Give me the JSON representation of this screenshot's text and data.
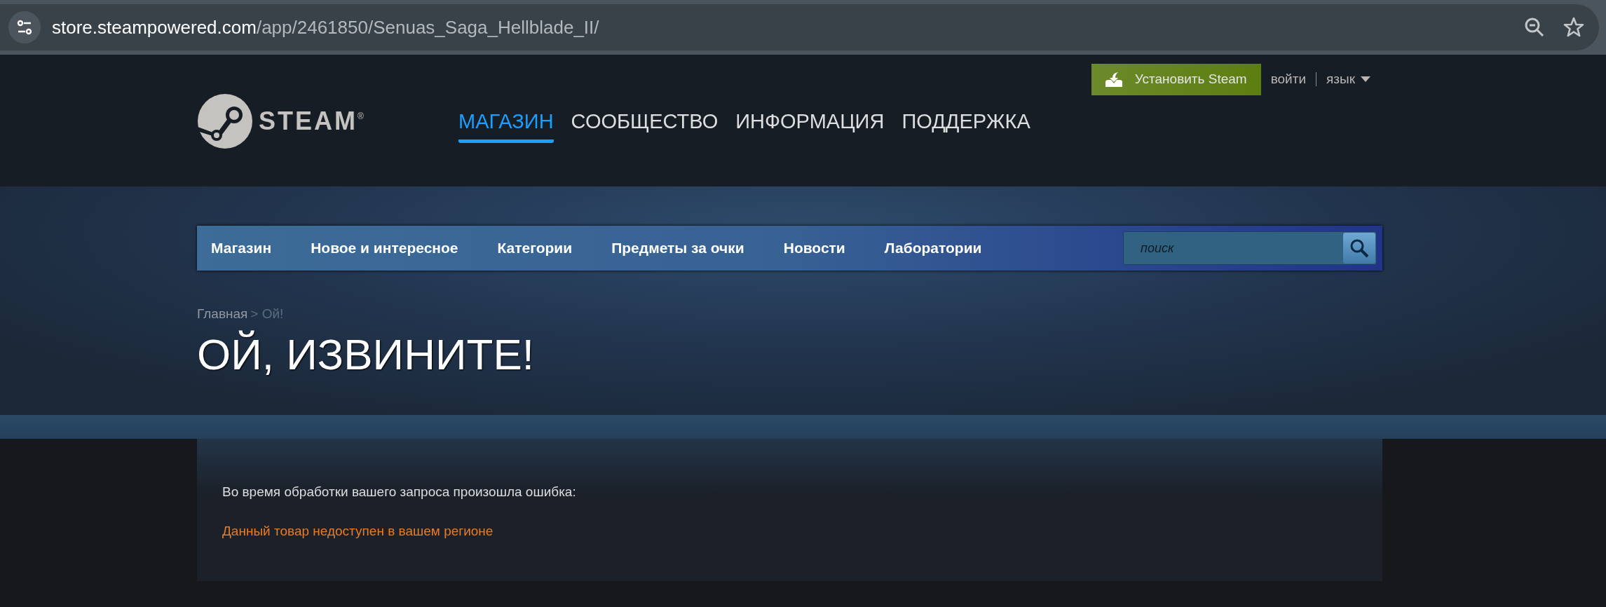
{
  "browser": {
    "url_host": "store.steampowered.com",
    "url_path": "/app/2461850/Senuas_Saga_Hellblade_II/"
  },
  "header": {
    "install_button": "Установить Steam",
    "login": "войти",
    "language": "язык",
    "logo_text": "STEAM",
    "logo_mark": "®",
    "main_nav": [
      {
        "label": "МАГАЗИН",
        "selected": true
      },
      {
        "label": "СООБЩЕСТВО",
        "selected": false
      },
      {
        "label": "ИНФОРМАЦИЯ",
        "selected": false
      },
      {
        "label": "ПОДДЕРЖКА",
        "selected": false
      }
    ]
  },
  "store_nav": {
    "items": [
      "Магазин",
      "Новое и интересное",
      "Категории",
      "Предметы за очки",
      "Новости",
      "Лаборатории"
    ],
    "search": {
      "placeholder": "поиск"
    }
  },
  "breadcrumb": {
    "items": [
      "Главная",
      "Ой!"
    ],
    "separator": ">"
  },
  "title": "ОЙ, ИЗВИНИТЕ!",
  "message": "Во время обработки вашего запроса произошла ошибка:",
  "error": "Данный товар недоступен в вашем регионе"
}
